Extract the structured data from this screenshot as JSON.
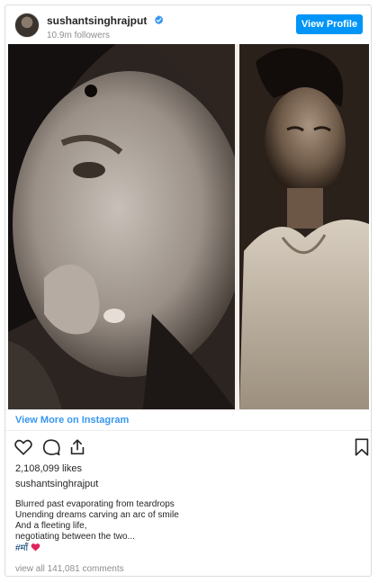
{
  "header": {
    "username": "sushantsinghrajput",
    "followers": "10.9m followers",
    "view_profile_label": "View Profile"
  },
  "post": {
    "view_more_label": "View More on Instagram",
    "likes": "2,108,099 likes",
    "owner": "sushantsinghrajput",
    "caption_lines": [
      "Blurred past evaporating from teardrops",
      "Unending dreams carving an arc of smile",
      "And a fleeting life,",
      "negotiating between the two..."
    ],
    "hashtag": "#माँ",
    "comments_label": "view all 141,081 comments"
  },
  "colors": {
    "accent": "#0095f6",
    "link": "#3897f0",
    "heart": "#e0245e",
    "verified": "#3897f0"
  },
  "icons": {
    "like": "heart-outline-icon",
    "comment": "comment-bubble-icon",
    "share": "share-arrow-icon",
    "save": "bookmark-icon"
  }
}
